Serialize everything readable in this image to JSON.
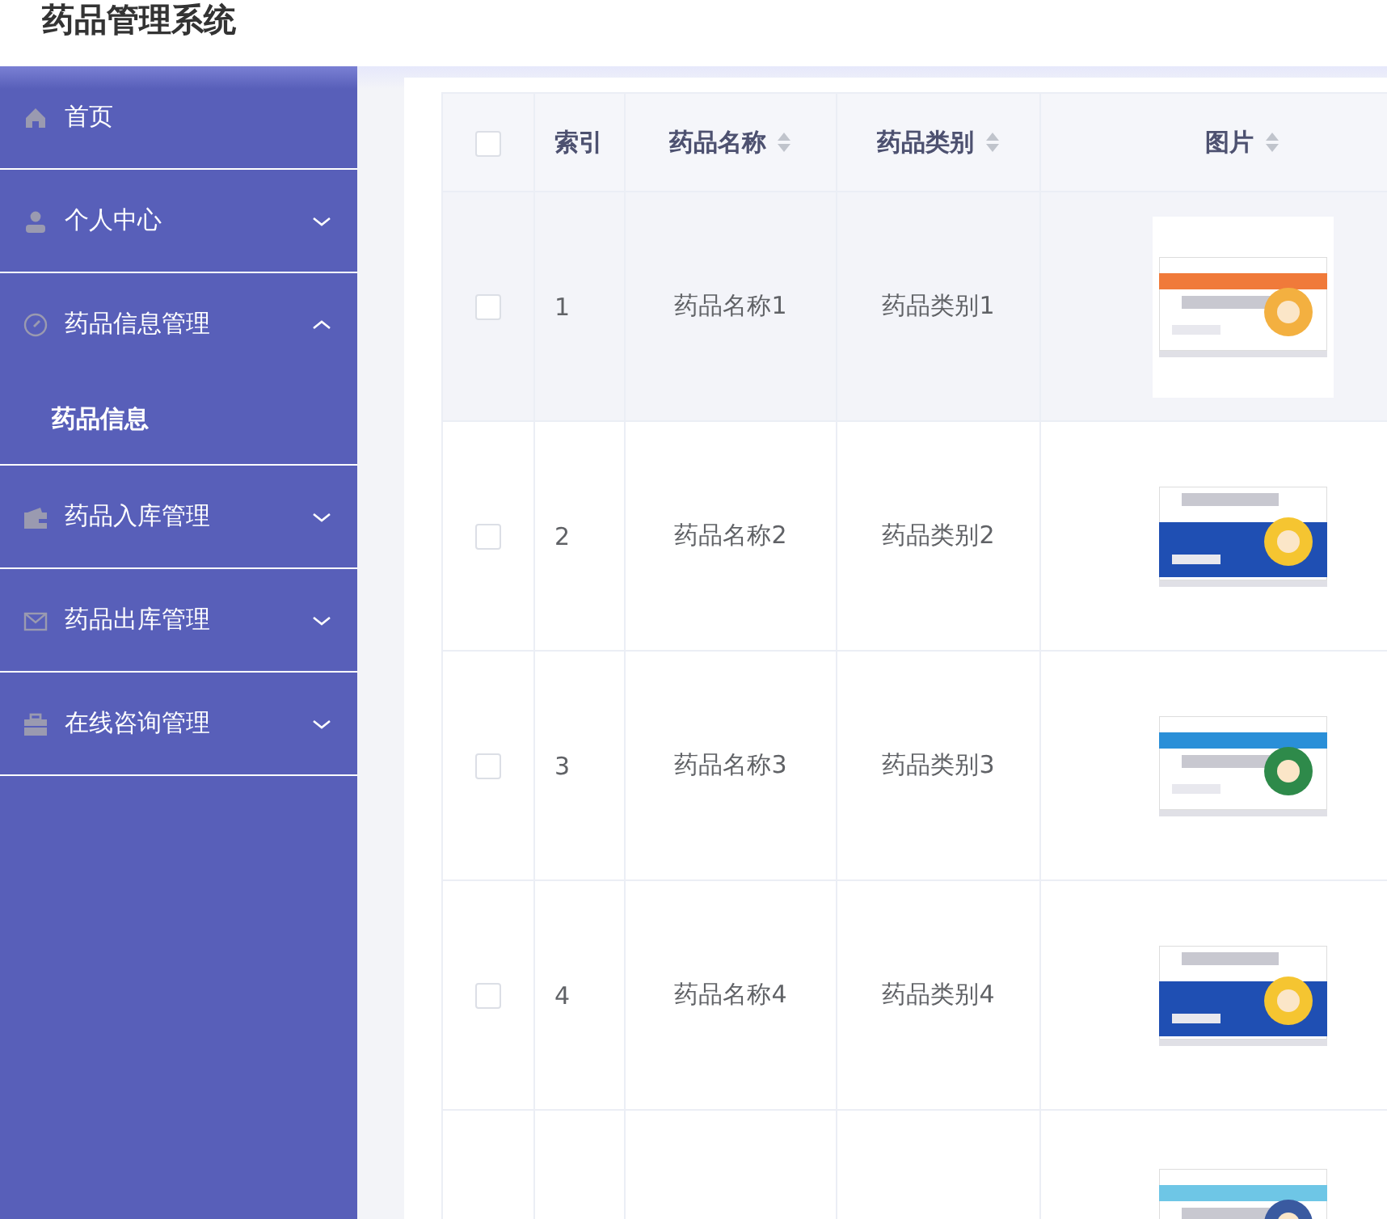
{
  "header": {
    "title": "药品管理系统"
  },
  "sidebar": {
    "items": [
      {
        "label": "首页"
      },
      {
        "label": "个人中心",
        "expanded": false
      },
      {
        "label": "药品信息管理",
        "expanded": true,
        "children": [
          {
            "label": "药品信息"
          }
        ]
      },
      {
        "label": "药品入库管理",
        "expanded": false
      },
      {
        "label": "药品出库管理",
        "expanded": false
      },
      {
        "label": "在线咨询管理",
        "expanded": false
      }
    ]
  },
  "table": {
    "select_all": {
      "checked": false
    },
    "columns": [
      {
        "label": "索引",
        "sortable": false
      },
      {
        "label": "药品名称",
        "sortable": true
      },
      {
        "label": "药品类别",
        "sortable": true
      },
      {
        "label": "图片",
        "sortable": true
      }
    ],
    "rows": [
      {
        "checked": false,
        "hovered": true,
        "index": "1",
        "name": "药品名称1",
        "category": "药品类别1",
        "image": {
          "kind": "picture"
        }
      },
      {
        "checked": false,
        "hovered": false,
        "index": "2",
        "name": "药品名称2",
        "category": "药品类别2",
        "image": {
          "kind": "picture"
        }
      },
      {
        "checked": false,
        "hovered": false,
        "index": "3",
        "name": "药品名称3",
        "category": "药品类别3",
        "image": {
          "kind": "picture"
        }
      },
      {
        "checked": false,
        "hovered": false,
        "index": "4",
        "name": "药品名称4",
        "category": "药品类别4",
        "image": {
          "kind": "picture"
        }
      },
      {
        "image": {
          "kind": "picture"
        }
      }
    ]
  }
}
